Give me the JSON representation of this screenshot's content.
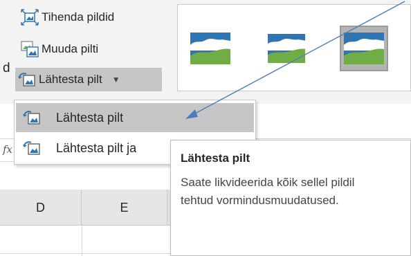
{
  "ribbon": {
    "cut_label": "d",
    "compress_label": "Tihenda pildid",
    "change_label": "Muuda pilti",
    "reset_label": "Lähtesta pilt",
    "reset_chevron": "▼"
  },
  "formula_bar": {
    "fx_label": "fx"
  },
  "sheet": {
    "columns": [
      "D",
      "E"
    ]
  },
  "menu": {
    "items": [
      {
        "label": "Lähtesta pilt",
        "icon": "reset-picture-icon"
      },
      {
        "label": "Lähtesta pilt ja",
        "icon": "reset-picture-icon"
      }
    ]
  },
  "tooltip": {
    "title": "Lähtesta pilt",
    "body": "Saate likvideerida kõik sellel pildil tehtud vormindusmuudatused."
  },
  "colors": {
    "ribbon_bg": "#f3f3f3",
    "selected_bg": "#c6c6c6",
    "annotation_arrow": "#4a7ebb",
    "picture_sky": "#2e75b6",
    "picture_hill": "#70ad47"
  }
}
